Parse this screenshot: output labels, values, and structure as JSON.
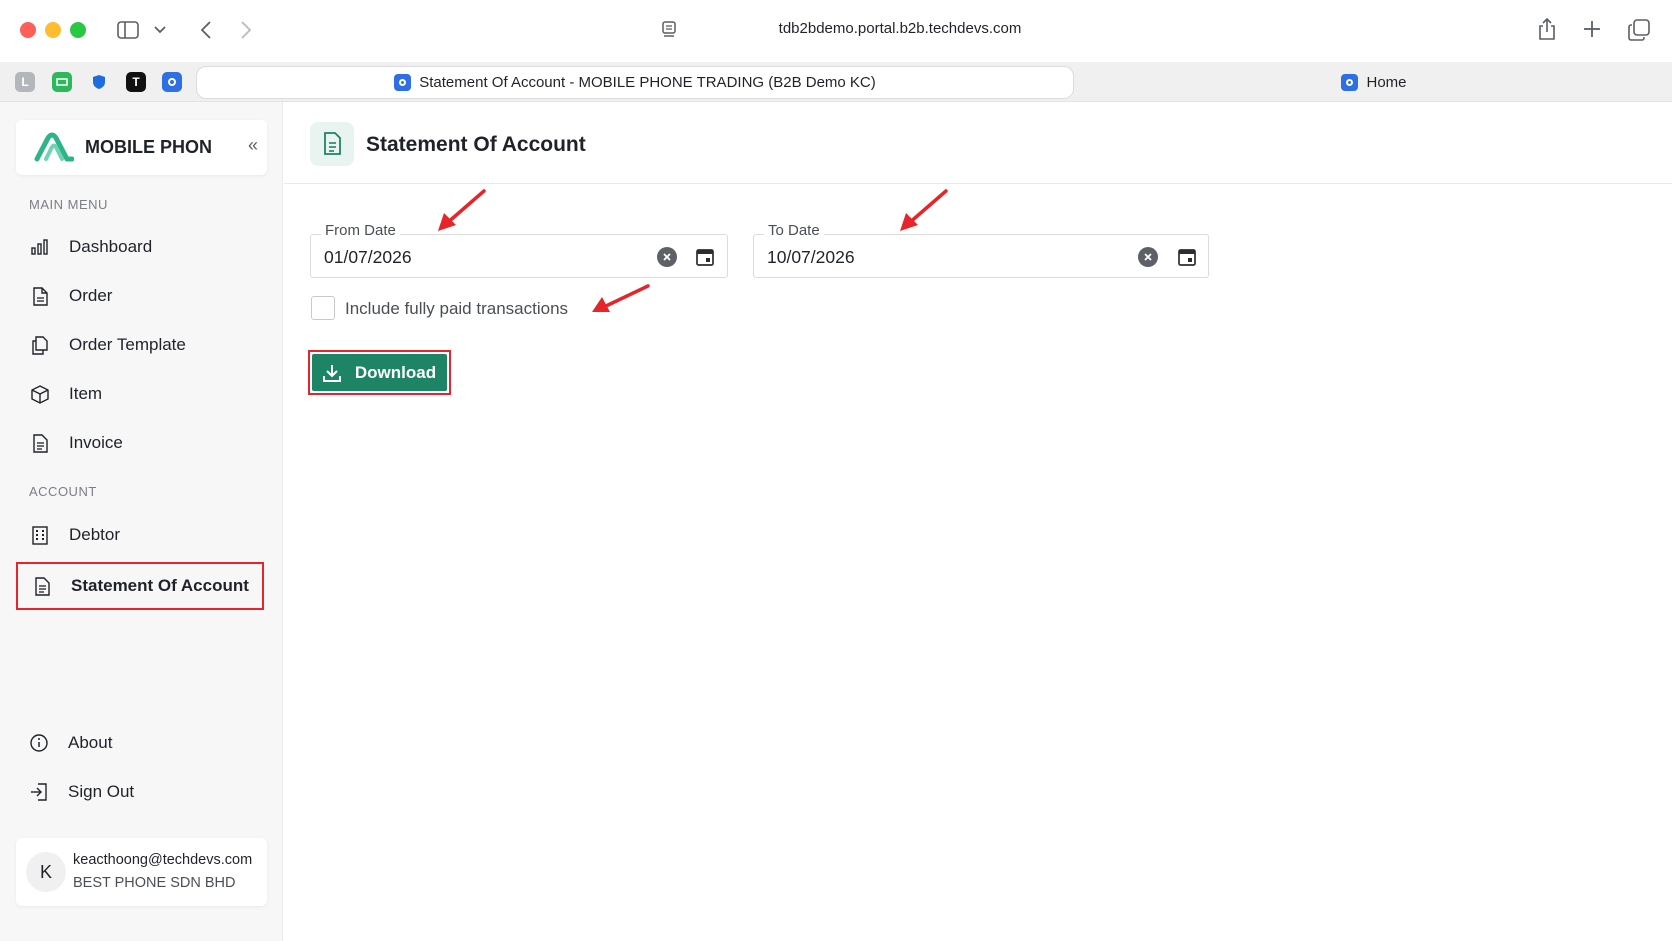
{
  "browser": {
    "url": "tdb2bdemo.portal.b2b.techdevs.com",
    "favorites": [
      "L",
      "",
      "",
      "T",
      ""
    ],
    "tabs": [
      {
        "label": "Statement Of Account - MOBILE PHONE TRADING (B2B Demo KC)",
        "active": true
      },
      {
        "label": "Home",
        "active": false
      }
    ]
  },
  "sidebar": {
    "brand": "MOBILE PHON",
    "collapse_glyph": "«",
    "main_menu_label": "MAIN MENU",
    "main_items": [
      {
        "label": "Dashboard",
        "icon": "bar-chart-icon"
      },
      {
        "label": "Order",
        "icon": "file-icon"
      },
      {
        "label": "Order Template",
        "icon": "copy-file-icon"
      },
      {
        "label": "Item",
        "icon": "cube-icon"
      },
      {
        "label": "Invoice",
        "icon": "document-icon"
      }
    ],
    "account_label": "ACCOUNT",
    "account_items": [
      {
        "label": "Debtor",
        "icon": "building-icon"
      },
      {
        "label": "Statement Of Account",
        "icon": "document-icon",
        "active": true
      }
    ],
    "bottom_items": [
      {
        "label": "About",
        "icon": "info-icon"
      },
      {
        "label": "Sign Out",
        "icon": "sign-out-icon"
      }
    ],
    "user": {
      "initial": "K",
      "email": "keacthoong@techdevs.com",
      "company": "BEST PHONE SDN BHD"
    }
  },
  "main": {
    "title": "Statement Of Account",
    "from_date": {
      "label": "From Date",
      "value": "01/07/2026"
    },
    "to_date": {
      "label": "To Date",
      "value": "10/07/2026"
    },
    "include_paid": {
      "label": "Include fully paid transactions",
      "checked": false
    },
    "download_label": "Download"
  },
  "colors": {
    "accent": "#1d8466",
    "highlight": "#e5252a",
    "annotation_arrow": "#e5252a"
  }
}
